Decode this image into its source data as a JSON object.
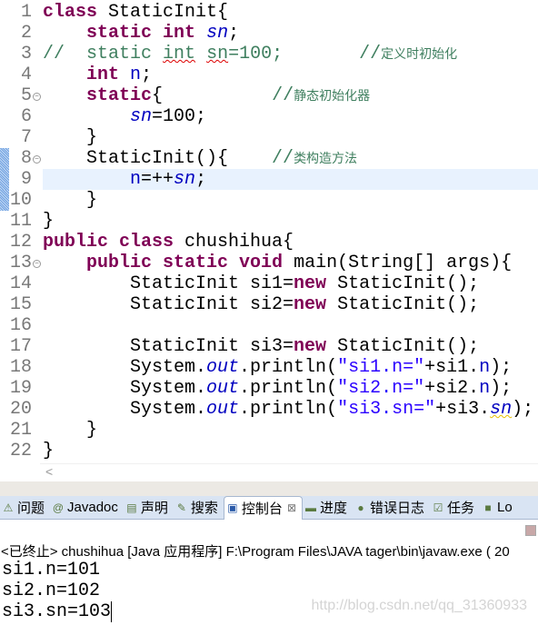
{
  "editor": {
    "highlighted_line": 9,
    "change_markers": [
      8,
      9,
      10
    ],
    "lines": [
      {
        "n": "1",
        "fold": false,
        "t": [
          [
            "kw",
            "class"
          ],
          [
            "txt",
            " StaticInit{"
          ]
        ]
      },
      {
        "n": "2",
        "fold": false,
        "t": [
          [
            "txt",
            "    "
          ],
          [
            "kw",
            "static int"
          ],
          [
            "txt",
            " "
          ],
          [
            "fld",
            "sn"
          ],
          [
            "txt",
            ";"
          ]
        ]
      },
      {
        "n": "3",
        "fold": false,
        "t": [
          [
            "cm",
            "//  static "
          ],
          [
            "cm sq",
            "int"
          ],
          [
            "cm",
            " "
          ],
          [
            "cm sq",
            "sn"
          ],
          [
            "cm",
            "=100;       //"
          ],
          [
            "cn",
            "定义时初始化"
          ]
        ]
      },
      {
        "n": "4",
        "fold": false,
        "t": [
          [
            "txt",
            "    "
          ],
          [
            "kw",
            "int"
          ],
          [
            "txt",
            " "
          ],
          [
            "var",
            "n"
          ],
          [
            "txt",
            ";"
          ]
        ]
      },
      {
        "n": "5",
        "fold": true,
        "t": [
          [
            "txt",
            "    "
          ],
          [
            "kw",
            "static"
          ],
          [
            "txt",
            "{          "
          ],
          [
            "cm",
            "//"
          ],
          [
            "cn",
            "静态初始化器"
          ]
        ]
      },
      {
        "n": "6",
        "fold": false,
        "t": [
          [
            "txt",
            "        "
          ],
          [
            "fld",
            "sn"
          ],
          [
            "txt",
            "=100;"
          ]
        ]
      },
      {
        "n": "7",
        "fold": false,
        "t": [
          [
            "txt",
            "    }"
          ]
        ]
      },
      {
        "n": "8",
        "fold": true,
        "t": [
          [
            "txt",
            "    StaticInit(){    "
          ],
          [
            "cm",
            "//"
          ],
          [
            "cn",
            "类构造方法"
          ]
        ]
      },
      {
        "n": "9",
        "fold": false,
        "t": [
          [
            "txt",
            "        "
          ],
          [
            "var",
            "n"
          ],
          [
            "txt",
            "=++"
          ],
          [
            "fld",
            "sn"
          ],
          [
            "txt",
            ";"
          ]
        ]
      },
      {
        "n": "10",
        "fold": false,
        "t": [
          [
            "txt",
            "    }"
          ]
        ]
      },
      {
        "n": "11",
        "fold": false,
        "t": [
          [
            "txt",
            "}"
          ]
        ]
      },
      {
        "n": "12",
        "fold": false,
        "t": [
          [
            "kw",
            "public class"
          ],
          [
            "txt",
            " chushihua{"
          ]
        ]
      },
      {
        "n": "13",
        "fold": true,
        "t": [
          [
            "txt",
            "    "
          ],
          [
            "kw",
            "public static void"
          ],
          [
            "txt",
            " main(String[] args){"
          ]
        ]
      },
      {
        "n": "14",
        "fold": false,
        "t": [
          [
            "txt",
            "        StaticInit si1="
          ],
          [
            "kw",
            "new"
          ],
          [
            "txt",
            " StaticInit();"
          ]
        ]
      },
      {
        "n": "15",
        "fold": false,
        "t": [
          [
            "txt",
            "        StaticInit si2="
          ],
          [
            "kw",
            "new"
          ],
          [
            "txt",
            " StaticInit();"
          ]
        ]
      },
      {
        "n": "16",
        "fold": false,
        "t": []
      },
      {
        "n": "17",
        "fold": false,
        "t": [
          [
            "txt",
            "        StaticInit si3="
          ],
          [
            "kw",
            "new"
          ],
          [
            "txt",
            " StaticInit();"
          ]
        ]
      },
      {
        "n": "18",
        "fold": false,
        "t": [
          [
            "txt",
            "        System."
          ],
          [
            "fld",
            "out"
          ],
          [
            "txt",
            ".println("
          ],
          [
            "str",
            "\"si1.n=\""
          ],
          [
            "txt",
            "+si1."
          ],
          [
            "var",
            "n"
          ],
          [
            "txt",
            ");"
          ]
        ]
      },
      {
        "n": "19",
        "fold": false,
        "t": [
          [
            "txt",
            "        System."
          ],
          [
            "fld",
            "out"
          ],
          [
            "txt",
            ".println("
          ],
          [
            "str",
            "\"si2.n=\""
          ],
          [
            "txt",
            "+si2."
          ],
          [
            "var",
            "n"
          ],
          [
            "txt",
            ");"
          ]
        ]
      },
      {
        "n": "20",
        "fold": false,
        "t": [
          [
            "txt",
            "        System."
          ],
          [
            "fld",
            "out"
          ],
          [
            "txt",
            ".println("
          ],
          [
            "str",
            "\"si3.sn=\""
          ],
          [
            "txt",
            "+si3."
          ],
          [
            "fld sqy",
            "sn"
          ],
          [
            "txt",
            ");"
          ]
        ]
      },
      {
        "n": "21",
        "fold": false,
        "t": [
          [
            "txt",
            "    }"
          ]
        ]
      },
      {
        "n": "22",
        "fold": false,
        "t": [
          [
            "txt",
            "}"
          ]
        ]
      }
    ],
    "scroll_left": "<"
  },
  "tabs": [
    {
      "label": "问题",
      "icon": "problems-icon",
      "glyph": "⚠",
      "active": false
    },
    {
      "label": "Javadoc",
      "icon": "javadoc-icon",
      "glyph": "@",
      "active": false
    },
    {
      "label": "声明",
      "icon": "declaration-icon",
      "glyph": "▤",
      "active": false
    },
    {
      "label": "搜索",
      "icon": "search-icon",
      "glyph": "✎",
      "active": false
    },
    {
      "label": "控制台",
      "icon": "console-icon",
      "glyph": "▣",
      "active": true,
      "close": "⊠"
    },
    {
      "label": "进度",
      "icon": "progress-icon",
      "glyph": "▬",
      "active": false
    },
    {
      "label": "错误日志",
      "icon": "error-log-icon",
      "glyph": "●",
      "active": false
    },
    {
      "label": "任务",
      "icon": "tasks-icon",
      "glyph": "☑",
      "active": false
    },
    {
      "label": "Lo",
      "icon": "log-icon",
      "glyph": "■",
      "active": false
    }
  ],
  "console": {
    "title": "<已终止> chushihua [Java 应用程序] F:\\Program Files\\JAVA tager\\bin\\javaw.exe ( 20",
    "output": [
      "si1.n=101",
      "si2.n=102",
      "si3.sn=103"
    ],
    "watermark": "http://blog.csdn.net/qq_31360933"
  }
}
